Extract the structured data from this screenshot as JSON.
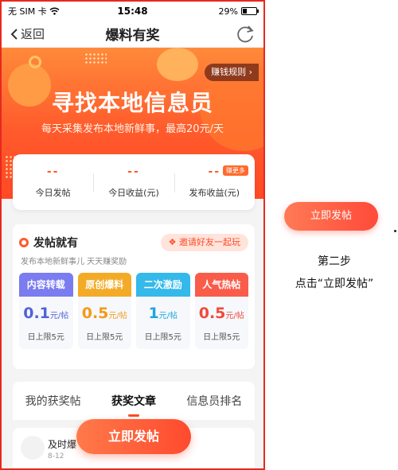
{
  "status_bar": {
    "carrier": "无 SIM 卡",
    "time": "15:48",
    "battery": "29%",
    "battery_level": 0.29
  },
  "nav": {
    "back_label": "返回",
    "title": "爆料有奖",
    "refresh_icon": "refresh-icon"
  },
  "banner": {
    "rules_label": "赚钱规则",
    "title": "寻找本地信息员",
    "subtitle": "每天采集发布本地新鲜事，最高20元/天"
  },
  "stats": [
    {
      "value": "--",
      "label": "今日发帖"
    },
    {
      "value": "--",
      "label": "今日收益(元)"
    },
    {
      "value": "--",
      "label": "发布收益(元)",
      "badge": "赚更多"
    }
  ],
  "post_section": {
    "title": "发帖就有",
    "subtitle": "发布本地新鲜事儿 天天赚奖励",
    "invite_label": "邀请好友一起玩",
    "tiles": [
      {
        "name": "内容转载",
        "price": "0.1",
        "unit": "元/帖",
        "limit": "日上限5元",
        "color": "#7a7cf0",
        "price_color": "#4f63d8"
      },
      {
        "name": "原创爆料",
        "price": "0.5",
        "unit": "元/帖",
        "limit": "日上限5元",
        "color": "#f3ab27",
        "price_color": "#f39a16"
      },
      {
        "name": "二次激励",
        "price": "1",
        "unit": "元/帖",
        "limit": "日上限5元",
        "color": "#34b9ea",
        "price_color": "#1ca6dd"
      },
      {
        "name": "人气热帖",
        "price": "0.5",
        "unit": "元/帖",
        "limit": "日上限5元",
        "color": "#fa5c4a",
        "price_color": "#f04a3c"
      }
    ]
  },
  "tabs": [
    {
      "label": "我的获奖帖",
      "active": false
    },
    {
      "label": "获奖文章",
      "active": true
    },
    {
      "label": "信息员排名",
      "active": false
    }
  ],
  "list_item": {
    "title": "及时爆",
    "date": "8-12"
  },
  "post_button": "立即发帖",
  "annotation": {
    "button_label": "立即发帖",
    "step": "第二步",
    "description": "点击“立即发帖”"
  }
}
